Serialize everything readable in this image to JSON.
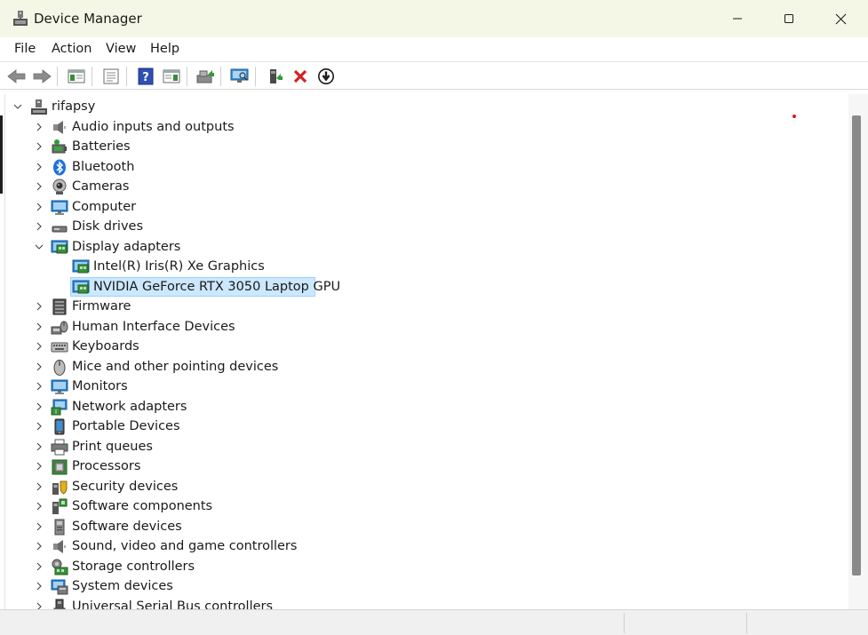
{
  "window": {
    "title": "Device Manager",
    "title_bar_color": "#f4f7e6",
    "selection_color": "#cce8ff"
  },
  "menu": [
    {
      "label": "File"
    },
    {
      "label": "Action"
    },
    {
      "label": "View"
    },
    {
      "label": "Help"
    }
  ],
  "toolbar_icons": [
    "back-arrow-icon",
    "forward-arrow-icon",
    "show-hide-tree-icon",
    "properties-icon",
    "help-icon",
    "action-pane-icon",
    "update-driver-icon",
    "scan-hardware-icon",
    "add-legacy-hardware-icon",
    "uninstall-device-icon",
    "disable-device-icon"
  ],
  "tree": {
    "root": {
      "label": "rifapsy",
      "expanded": true
    },
    "categories": [
      {
        "label": "Audio inputs and outputs",
        "icon": "speaker-icon"
      },
      {
        "label": "Batteries",
        "icon": "battery-icon"
      },
      {
        "label": "Bluetooth",
        "icon": "bluetooth-icon"
      },
      {
        "label": "Cameras",
        "icon": "camera-icon"
      },
      {
        "label": "Computer",
        "icon": "computer-icon"
      },
      {
        "label": "Disk drives",
        "icon": "disk-drive-icon"
      },
      {
        "label": "Display adapters",
        "icon": "display-adapter-icon",
        "expanded": true,
        "children": [
          {
            "label": "Intel(R) Iris(R) Xe Graphics",
            "icon": "display-adapter-icon"
          },
          {
            "label": "NVIDIA GeForce RTX 3050 Laptop GPU",
            "icon": "display-adapter-icon",
            "selected": true
          }
        ]
      },
      {
        "label": "Firmware",
        "icon": "firmware-icon"
      },
      {
        "label": "Human Interface Devices",
        "icon": "hid-icon"
      },
      {
        "label": "Keyboards",
        "icon": "keyboard-icon"
      },
      {
        "label": "Mice and other pointing devices",
        "icon": "mouse-icon"
      },
      {
        "label": "Monitors",
        "icon": "monitor-icon"
      },
      {
        "label": "Network adapters",
        "icon": "network-adapter-icon"
      },
      {
        "label": "Portable Devices",
        "icon": "portable-device-icon"
      },
      {
        "label": "Print queues",
        "icon": "printer-icon"
      },
      {
        "label": "Processors",
        "icon": "processor-icon"
      },
      {
        "label": "Security devices",
        "icon": "security-device-icon"
      },
      {
        "label": "Software components",
        "icon": "software-component-icon"
      },
      {
        "label": "Software devices",
        "icon": "software-device-icon"
      },
      {
        "label": "Sound, video and game controllers",
        "icon": "sound-controller-icon"
      },
      {
        "label": "Storage controllers",
        "icon": "storage-controller-icon"
      },
      {
        "label": "System devices",
        "icon": "system-device-icon"
      },
      {
        "label": "Universal Serial Bus controllers",
        "icon": "usb-icon"
      }
    ]
  }
}
